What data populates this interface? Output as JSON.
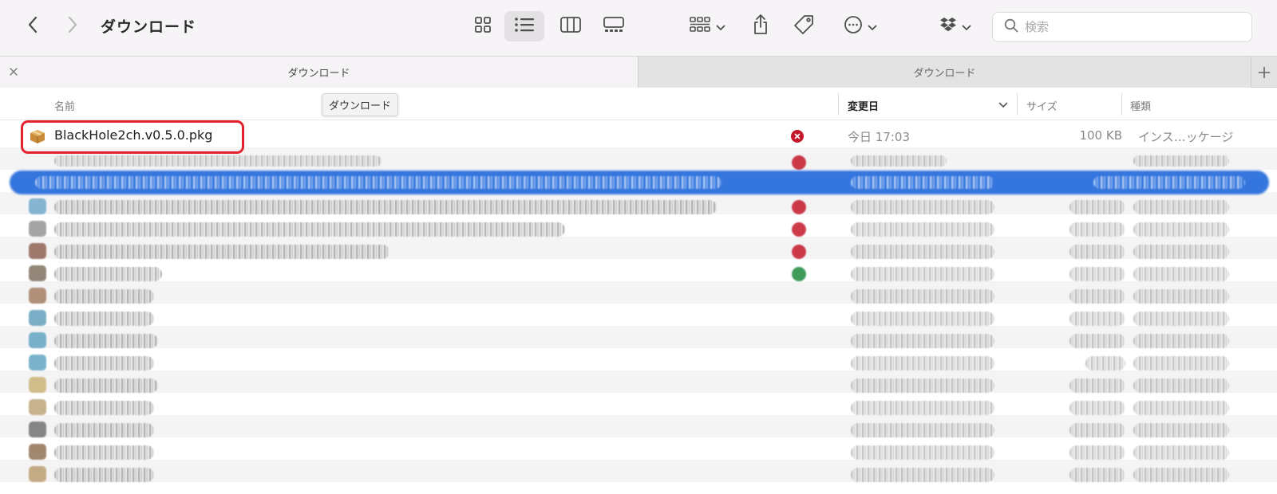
{
  "window": {
    "title": "ダウンロード"
  },
  "toolbar": {
    "back_icon": "chevron-left-icon",
    "forward_icon": "chevron-right-icon",
    "views": [
      "icon-view-icon",
      "list-view-icon",
      "column-view-icon",
      "gallery-view-icon"
    ],
    "active_view": "list-view-icon"
  },
  "search": {
    "placeholder": "検索"
  },
  "tabs": [
    {
      "label": "ダウンロード",
      "active": true
    },
    {
      "label": "ダウンロード",
      "active": false
    }
  ],
  "tooltip": {
    "text": "ダウンロード"
  },
  "columns": {
    "name": "名前",
    "date": "変更日",
    "size": "サイズ",
    "kind": "種類"
  },
  "files": [
    {
      "name": "BlackHole2ch.v0.5.0.pkg",
      "date": "今日 17:03",
      "size": "100 KB",
      "kind": "インス…ッケージ",
      "icon": "package-icon",
      "status": "error-badge-icon",
      "status_color": "#c4182b"
    }
  ],
  "colors": {
    "selection": "#2a6fdc",
    "highlight_border": "#e3222e",
    "status_red": "#c4182b",
    "status_green": "#1e8a3c"
  }
}
